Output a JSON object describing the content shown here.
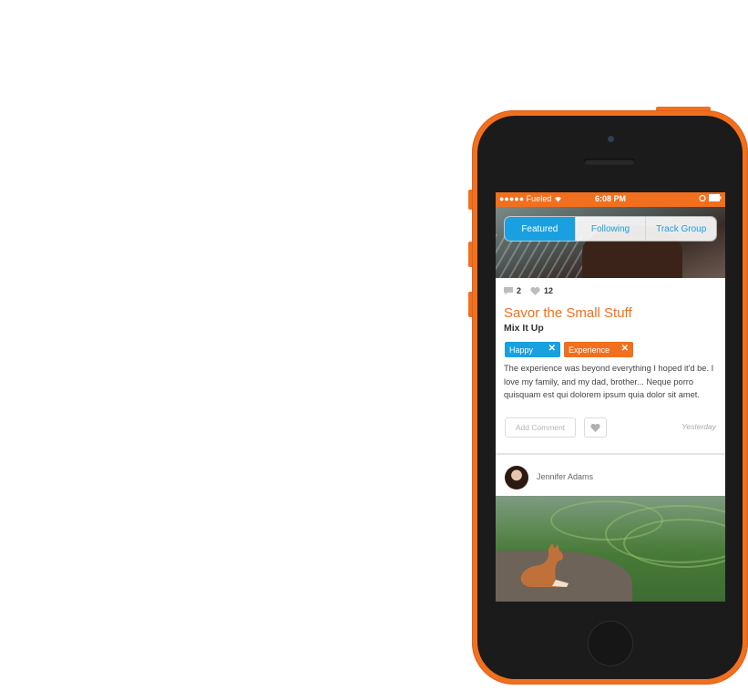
{
  "status_bar": {
    "carrier": "●●●●● Fueled",
    "time": "6:08 PM"
  },
  "tabs": [
    {
      "label": "Featured",
      "active": true
    },
    {
      "label": "Following",
      "active": false
    },
    {
      "label": "Track Group",
      "active": false
    }
  ],
  "post": {
    "comments_count": "2",
    "likes_count": "12",
    "title": "Savor the Small Stuff",
    "subtitle": "Mix It Up",
    "tags": [
      {
        "label": "Happy",
        "color": "#1aa0e0"
      },
      {
        "label": "Experience",
        "color": "#f26f1e"
      }
    ],
    "body": "The experience was beyond everything I hoped it'd be. I love my family, and my dad, brother... Neque porro quisquam est qui dolorem ipsum quia dolor sit amet.",
    "add_comment_placeholder": "Add Comment",
    "timestamp": "Yesterday"
  },
  "next_post": {
    "author": "Jennifer Adams"
  },
  "theme": {
    "accent_orange": "#f26f1e",
    "accent_blue": "#1aa0e0"
  }
}
